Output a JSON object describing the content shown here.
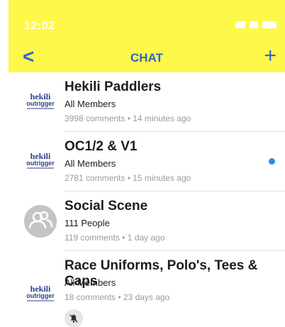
{
  "status_bar": {
    "time": "12:02",
    "icons": [
      "location-arrow-icon",
      "signal-icon",
      "wifi-icon",
      "battery-icon"
    ]
  },
  "header": {
    "title": "CHAT",
    "back_icon": "<",
    "add_icon": "+",
    "background_color": "#fef84a",
    "accent_color": "#2a62d9"
  },
  "chats": [
    {
      "title": "Hekili Paddlers",
      "subtitle": "All Members",
      "meta": "3998 comments • 14 minutes ago",
      "avatar": "hekili-outrigger-logo",
      "unread": false
    },
    {
      "title": "OC1/2 & V1",
      "subtitle": "All Members",
      "meta": "2781 comments • 15 minutes ago",
      "avatar": "hekili-outrigger-logo",
      "unread": true
    },
    {
      "title": "Social Scene",
      "subtitle": "111 People",
      "meta": "119 comments • 1 day ago",
      "avatar": "people-icon",
      "unread": false
    },
    {
      "title": "Race Uniforms, Polo's, Tees & Caps",
      "subtitle": "All Members",
      "meta": "18 comments • 23 days ago",
      "avatar": "hekili-outrigger-logo",
      "muted": true
    }
  ]
}
